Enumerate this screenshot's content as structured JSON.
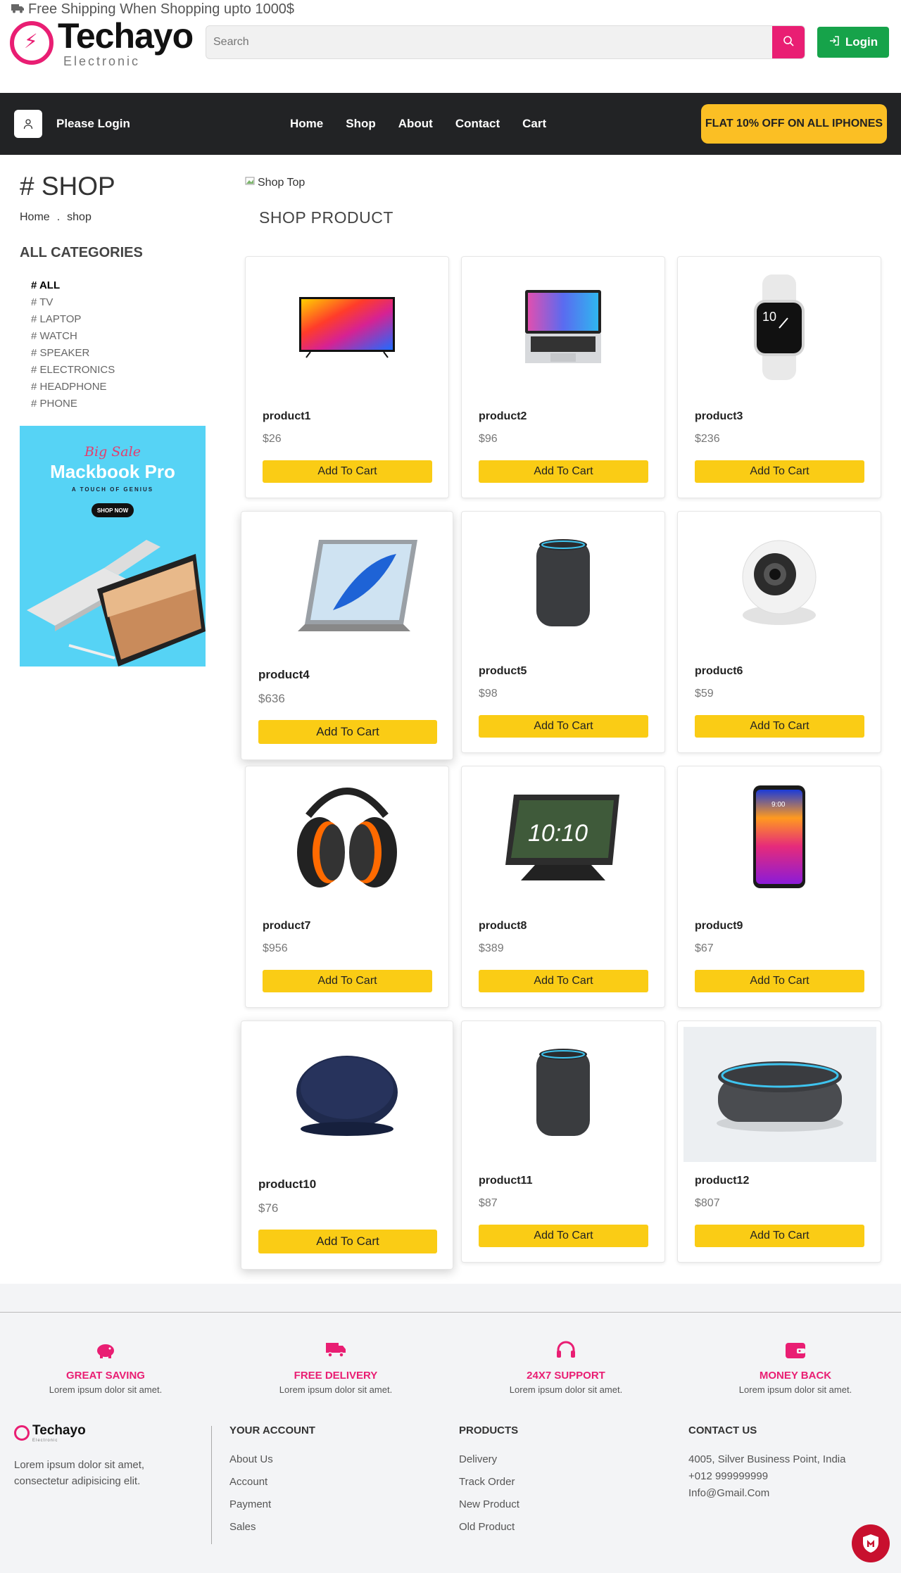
{
  "topbar": {
    "shipping_text": "Free Shipping When Shopping upto 1000$",
    "logo_title": "Techayo",
    "logo_subtitle": "Electronic",
    "search_placeholder": "Search",
    "login_label": "Login"
  },
  "nav": {
    "user_label": "Please Login",
    "links": [
      "Home",
      "Shop",
      "About",
      "Contact",
      "Cart"
    ],
    "promo": "FLAT 10% OFF ON ALL IPHONES"
  },
  "sidebar": {
    "title": "# SHOP",
    "breadcrumb": [
      "Home",
      ".",
      "shop"
    ],
    "categories_heading": "ALL CATEGORIES",
    "categories": [
      "# ALL",
      "# TV",
      "# LAPTOP",
      "# WATCH",
      "# SPEAKER",
      "# ELECTRONICS",
      "# HEADPHONE",
      "# PHONE"
    ],
    "ad": {
      "tagline": "Big Sale",
      "title": "Mackbook Pro",
      "subtitle": "A TOUCH OF GENIUS",
      "cta": "SHOP NOW"
    }
  },
  "main": {
    "shop_top_alt": "Shop Top",
    "heading": "SHOP PRODUCT",
    "cart_label": "Add To Cart",
    "products": [
      {
        "name": "product1",
        "price": "$26",
        "icon": "tv-icon"
      },
      {
        "name": "product2",
        "price": "$96",
        "icon": "laptop-icon"
      },
      {
        "name": "product3",
        "price": "$236",
        "icon": "watch-icon"
      },
      {
        "name": "product4",
        "price": "$636",
        "icon": "tablet-icon"
      },
      {
        "name": "product5",
        "price": "$98",
        "icon": "speaker-icon"
      },
      {
        "name": "product6",
        "price": "$59",
        "icon": "camera-icon"
      },
      {
        "name": "product7",
        "price": "$956",
        "icon": "earmuff-icon"
      },
      {
        "name": "product8",
        "price": "$389",
        "icon": "smart-display-icon"
      },
      {
        "name": "product9",
        "price": "$67",
        "icon": "phone-icon"
      },
      {
        "name": "product10",
        "price": "$76",
        "icon": "charger-icon"
      },
      {
        "name": "product11",
        "price": "$87",
        "icon": "speaker-icon"
      },
      {
        "name": "product12",
        "price": "$807",
        "icon": "smart-speaker-icon"
      }
    ]
  },
  "features": [
    {
      "title": "GREAT SAVING",
      "sub": "Lorem ipsum dolor sit amet.",
      "icon": "piggy-bank-icon"
    },
    {
      "title": "FREE DELIVERY",
      "sub": "Lorem ipsum dolor sit amet.",
      "icon": "truck-icon"
    },
    {
      "title": "24X7 SUPPORT",
      "sub": "Lorem ipsum dolor sit amet.",
      "icon": "headset-icon"
    },
    {
      "title": "MONEY BACK",
      "sub": "Lorem ipsum dolor sit amet.",
      "icon": "wallet-icon"
    }
  ],
  "footer": {
    "logo_title": "Techayo",
    "logo_subtitle": "Electronic",
    "about": "Lorem ipsum dolor sit amet, consectetur adipisicing elit.",
    "account_heading": "YOUR ACCOUNT",
    "account_links": [
      "About Us",
      "Account",
      "Payment",
      "Sales"
    ],
    "products_heading": "PRODUCTS",
    "products_links": [
      "Delivery",
      "Track Order",
      "New Product",
      "Old Product"
    ],
    "contact_heading": "CONTACT US",
    "contact_lines": [
      "4005, Silver Business Point, India",
      "+012 999999999",
      "Info@Gmail.Com"
    ]
  },
  "colors": {
    "accent": "#e91e73",
    "nav_bg": "#222325",
    "cart_button": "#facc15",
    "login_button": "#16a34a"
  }
}
